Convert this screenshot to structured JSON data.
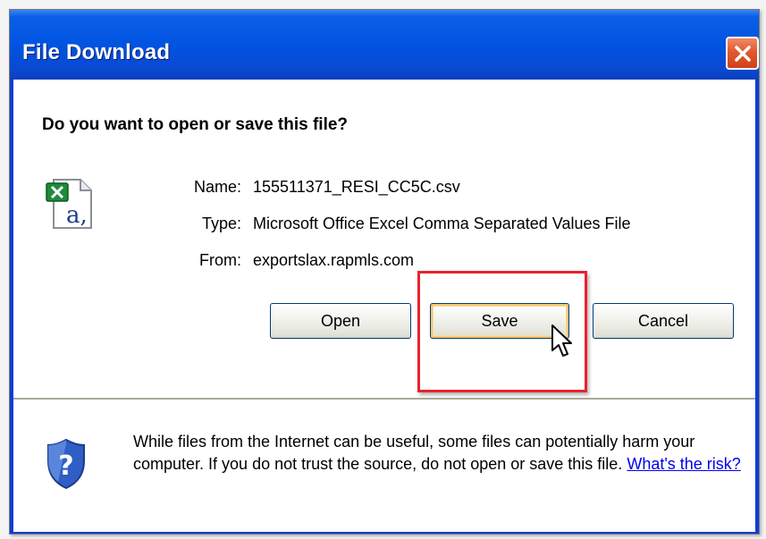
{
  "dialog": {
    "title": "File Download",
    "question": "Do you want to open or save this file?",
    "file": {
      "icon": "excel-csv-file-icon",
      "name_label": "Name:",
      "name_value": "155511371_RESI_CC5C.csv",
      "type_label": "Type:",
      "type_value": "Microsoft Office Excel Comma Separated Values File",
      "from_label": "From:",
      "from_value": "exportslax.rapmls.com"
    },
    "buttons": {
      "open": "Open",
      "save": "Save",
      "cancel": "Cancel"
    },
    "warning": {
      "icon": "security-shield-question-icon",
      "text": "While files from the Internet can be useful, some files can potentially harm your computer. If you do not trust the source, do not open or save this file.",
      "link": "What's the risk?"
    }
  },
  "colors": {
    "titlebar": "#0052e0",
    "close_button": "#e2582e",
    "highlight": "#e8232b",
    "link": "#0000ee"
  }
}
